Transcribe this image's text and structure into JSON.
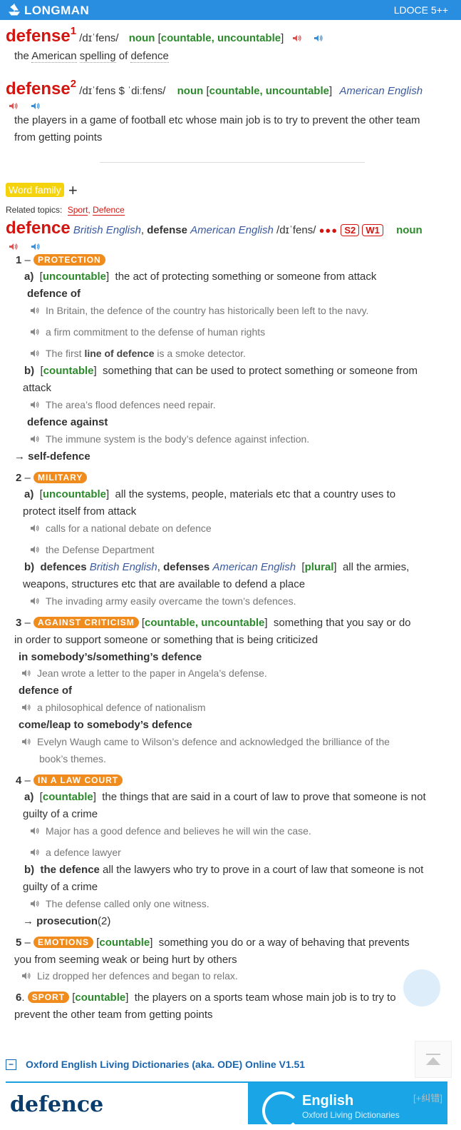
{
  "header": {
    "brand": "LONGMAN",
    "version": "LDOCE 5++"
  },
  "entry1": {
    "headword": "defense",
    "sup": "1",
    "pron": "/dɪˈfens/",
    "pos": "noun",
    "gram_open": "[",
    "gram": "countable, uncountable",
    "gram_close": "]",
    "def_pre": "the ",
    "def_w1": "American",
    "def_sp": " ",
    "def_w2": "spelling",
    "def_mid": " of ",
    "def_w3": "defence"
  },
  "entry2": {
    "headword": "defense",
    "sup": "2",
    "pron": "/dɪˈfens $ ˈdiːfens/",
    "pos": "noun",
    "gram": "countable, uncountable",
    "region": "American English",
    "def_line1": "the players in a game of football etc whose main job is to try to prevent the other team",
    "def_line2": "from getting points"
  },
  "word_family": {
    "label": "Word family",
    "toggle": "+"
  },
  "related": {
    "label": "Related topics:",
    "t1": "Sport",
    "sep": ",",
    "t2": "Defence"
  },
  "entry3": {
    "headword": "defence",
    "region1": "British English",
    "comma": ",",
    "alt": "defense",
    "region2": "American English",
    "pron": "/dɪˈfens/",
    "freq": "●●●",
    "s": "S2",
    "w": "W1",
    "pos": "noun"
  },
  "senses": {
    "s1": {
      "num": "1",
      "dash": "–",
      "label": "PROTECTION"
    },
    "s1a": {
      "letter": "a)",
      "gram": "uncountable",
      "def": "the act of protecting something or someone from attack"
    },
    "s1a_colloc": "defence of",
    "s1a_ex1": "In Britain, the defence of the country has historically been left to the navy.",
    "s1a_ex2": "a firm commitment to the defense of human rights",
    "s1a_ex3_pre": "The first ",
    "s1a_ex3_b": "line of defence",
    "s1a_ex3_post": " is a smoke detector.",
    "s1b": {
      "letter": "b)",
      "gram": "countable",
      "def1": "something that can be used to protect something or someone from",
      "def2": "attack"
    },
    "s1b_ex1": "The area’s flood defences need repair.",
    "s1b_colloc": "defence against",
    "s1b_ex2": "The immune system is the body’s defence against infection.",
    "s1_xref_arrow": "→",
    "s1_xref": "self-defence",
    "s2": {
      "num": "2",
      "dash": "–",
      "label": "MILITARY"
    },
    "s2a": {
      "letter": "a)",
      "gram": "uncountable",
      "def1": "all the systems, people, materials etc that a country uses to",
      "def2": "protect itself from attack"
    },
    "s2a_ex1": "calls for a national debate on defence",
    "s2a_ex2": "the Defense Department",
    "s2b": {
      "letter": "b)",
      "w1": "defences",
      "r1": "British English",
      "comma": ",",
      "w2": "defenses",
      "r2": "American English",
      "gram": "plural",
      "def1": "all the armies,",
      "def2": "weapons, structures etc that are available to defend a place"
    },
    "s2b_ex1": "The invading army easily overcame the town’s defences.",
    "s3": {
      "num": "3",
      "dash": "–",
      "label": "AGAINST CRITICISM",
      "gram": "countable, uncountable",
      "def1": "something that you say or do",
      "def2": "in order to support someone or something that is being criticized"
    },
    "s3_c1": "in somebody’s/something’s defence",
    "s3_ex1": "Jean wrote a letter to the paper in Angela’s defense.",
    "s3_c2": "defence of",
    "s3_ex2": "a philosophical defence of nationalism",
    "s3_c3": "come/leap to somebody’s defence",
    "s3_ex3a": "Evelyn Waugh came to Wilson’s defence and acknowledged the brilliance of the",
    "s3_ex3b": "book’s themes.",
    "s4": {
      "num": "4",
      "dash": "–",
      "label": "IN A LAW COURT"
    },
    "s4a": {
      "letter": "a)",
      "gram": "countable",
      "def1": "the things that are said in a court of law to prove that someone is not",
      "def2": "guilty of a crime"
    },
    "s4a_ex1": "Major has a good defence and believes he will win the case.",
    "s4a_ex2": "a defence lawyer",
    "s4b": {
      "letter": "b)",
      "w": "the defence",
      "def1": "all the lawyers who try to prove in a court of law that someone is not",
      "def2": "guilty of a crime"
    },
    "s4b_ex1": "The defense called only one witness.",
    "s4_xref_arrow": "→",
    "s4_xref": "prosecution",
    "s4_xref_num": "(2)",
    "s5": {
      "num": "5",
      "dash": "–",
      "label": "EMOTIONS",
      "gram": "countable",
      "def1": "something you do or a way of behaving that prevents",
      "def2": "you from seeming weak or being hurt by others"
    },
    "s5_ex1": "Liz dropped her defences and began to relax.",
    "s6": {
      "num": "6",
      "dot": ".",
      "label": "SPORT",
      "gram": "countable",
      "def1": "the players on a sports team whose main job is to try to",
      "def2": "prevent the other team from getting points"
    }
  },
  "ode": {
    "toggle": "−",
    "title": "Oxford English Living Dictionaries (aka. ODE) Online V1.51",
    "word": "defence",
    "brand": "English",
    "sub": "Oxford Living Dictionaries",
    "correct": "[+纠错]"
  },
  "icons": {
    "speaker_uk": "speaker-red-icon",
    "speaker_us": "speaker-blue-icon",
    "example": "example-speaker-icon",
    "scroll": "scroll-to-top-icon"
  },
  "colors": {
    "red": "#d4140e",
    "green": "#2c8a2c",
    "blue": "#2a8ee0",
    "orange": "#f08c1e",
    "yellow": "#f5d30c"
  }
}
